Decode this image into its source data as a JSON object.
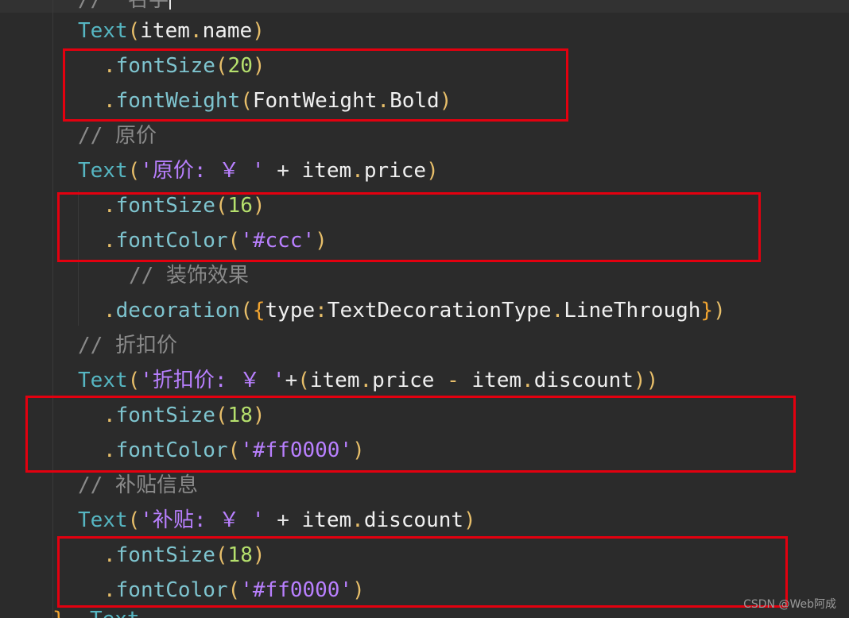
{
  "editor": {
    "lines": [
      {
        "id": "l0",
        "segments": [
          {
            "t": "//  ",
            "c": "tok-comment"
          },
          {
            "t": "名字",
            "c": "tok-comment"
          }
        ]
      },
      {
        "id": "l1",
        "segments": [
          {
            "t": "Text",
            "c": "tok-fn"
          },
          {
            "t": "(",
            "c": "tok-punc"
          },
          {
            "t": "item",
            "c": "tok-ident"
          },
          {
            "t": ".",
            "c": "tok-dot"
          },
          {
            "t": "name",
            "c": "tok-ident"
          },
          {
            "t": ")",
            "c": "tok-punc"
          }
        ]
      },
      {
        "id": "l2",
        "segments": [
          {
            "t": ".",
            "c": "tok-dot"
          },
          {
            "t": "fontSize",
            "c": "tok-method"
          },
          {
            "t": "(",
            "c": "tok-punc"
          },
          {
            "t": "20",
            "c": "tok-num"
          },
          {
            "t": ")",
            "c": "tok-punc"
          }
        ]
      },
      {
        "id": "l3",
        "segments": [
          {
            "t": ".",
            "c": "tok-dot"
          },
          {
            "t": "fontWeight",
            "c": "tok-method"
          },
          {
            "t": "(",
            "c": "tok-punc"
          },
          {
            "t": "FontWeight",
            "c": "tok-ident"
          },
          {
            "t": ".",
            "c": "tok-dot"
          },
          {
            "t": "Bold",
            "c": "tok-ident"
          },
          {
            "t": ")",
            "c": "tok-punc"
          }
        ]
      },
      {
        "id": "l4",
        "segments": [
          {
            "t": "// 原价",
            "c": "tok-comment"
          }
        ]
      },
      {
        "id": "l5",
        "segments": [
          {
            "t": "Text",
            "c": "tok-fn"
          },
          {
            "t": "(",
            "c": "tok-punc"
          },
          {
            "t": "'原价: ￥ '",
            "c": "tok-str"
          },
          {
            "t": " + ",
            "c": "tok-op"
          },
          {
            "t": "item",
            "c": "tok-ident"
          },
          {
            "t": ".",
            "c": "tok-dot"
          },
          {
            "t": "price",
            "c": "tok-ident"
          },
          {
            "t": ")",
            "c": "tok-punc"
          }
        ]
      },
      {
        "id": "l6",
        "segments": [
          {
            "t": ".",
            "c": "tok-dot"
          },
          {
            "t": "fontSize",
            "c": "tok-method"
          },
          {
            "t": "(",
            "c": "tok-punc"
          },
          {
            "t": "16",
            "c": "tok-num"
          },
          {
            "t": ")",
            "c": "tok-punc"
          }
        ]
      },
      {
        "id": "l7",
        "segments": [
          {
            "t": ".",
            "c": "tok-dot"
          },
          {
            "t": "fontColor",
            "c": "tok-method"
          },
          {
            "t": "(",
            "c": "tok-punc"
          },
          {
            "t": "'#ccc'",
            "c": "tok-str"
          },
          {
            "t": ")",
            "c": "tok-punc"
          }
        ]
      },
      {
        "id": "l8",
        "segments": [
          {
            "t": "// 装饰效果",
            "c": "tok-comment"
          }
        ]
      },
      {
        "id": "l9",
        "segments": [
          {
            "t": ".",
            "c": "tok-dot"
          },
          {
            "t": "decoration",
            "c": "tok-method"
          },
          {
            "t": "(",
            "c": "tok-punc"
          },
          {
            "t": "{",
            "c": "tok-brace"
          },
          {
            "t": "type",
            "c": "tok-ident"
          },
          {
            "t": ":",
            "c": "tok-dot"
          },
          {
            "t": "TextDecorationType",
            "c": "tok-ident"
          },
          {
            "t": ".",
            "c": "tok-dot"
          },
          {
            "t": "LineThrough",
            "c": "tok-ident"
          },
          {
            "t": "}",
            "c": "tok-brace"
          },
          {
            "t": ")",
            "c": "tok-punc"
          }
        ]
      },
      {
        "id": "l10",
        "segments": [
          {
            "t": "// 折扣价",
            "c": "tok-comment"
          }
        ]
      },
      {
        "id": "l11",
        "segments": [
          {
            "t": "Text",
            "c": "tok-fn"
          },
          {
            "t": "(",
            "c": "tok-punc"
          },
          {
            "t": "'折扣价: ￥ '",
            "c": "tok-str"
          },
          {
            "t": "+",
            "c": "tok-op"
          },
          {
            "t": "(",
            "c": "tok-punc"
          },
          {
            "t": "item",
            "c": "tok-ident"
          },
          {
            "t": ".",
            "c": "tok-dot"
          },
          {
            "t": "price",
            "c": "tok-ident"
          },
          {
            "t": " - ",
            "c": "tok-punc"
          },
          {
            "t": "item",
            "c": "tok-ident"
          },
          {
            "t": ".",
            "c": "tok-dot"
          },
          {
            "t": "discount",
            "c": "tok-ident"
          },
          {
            "t": "))",
            "c": "tok-punc"
          }
        ]
      },
      {
        "id": "l12",
        "segments": [
          {
            "t": ".",
            "c": "tok-dot"
          },
          {
            "t": "fontSize",
            "c": "tok-method"
          },
          {
            "t": "(",
            "c": "tok-punc"
          },
          {
            "t": "18",
            "c": "tok-num"
          },
          {
            "t": ")",
            "c": "tok-punc"
          }
        ]
      },
      {
        "id": "l13",
        "segments": [
          {
            "t": ".",
            "c": "tok-dot"
          },
          {
            "t": "fontColor",
            "c": "tok-method"
          },
          {
            "t": "(",
            "c": "tok-punc"
          },
          {
            "t": "'#ff0000'",
            "c": "tok-str"
          },
          {
            "t": ")",
            "c": "tok-punc"
          }
        ]
      },
      {
        "id": "l14",
        "segments": [
          {
            "t": "// 补贴信息",
            "c": "tok-comment"
          }
        ]
      },
      {
        "id": "l15",
        "segments": [
          {
            "t": "Text",
            "c": "tok-fn"
          },
          {
            "t": "(",
            "c": "tok-punc"
          },
          {
            "t": "'补贴: ￥ '",
            "c": "tok-str"
          },
          {
            "t": " + ",
            "c": "tok-op"
          },
          {
            "t": "item",
            "c": "tok-ident"
          },
          {
            "t": ".",
            "c": "tok-dot"
          },
          {
            "t": "discount",
            "c": "tok-ident"
          },
          {
            "t": ")",
            "c": "tok-punc"
          }
        ]
      },
      {
        "id": "l16",
        "segments": [
          {
            "t": ".",
            "c": "tok-dot"
          },
          {
            "t": "fontSize",
            "c": "tok-method"
          },
          {
            "t": "(",
            "c": "tok-punc"
          },
          {
            "t": "18",
            "c": "tok-num"
          },
          {
            "t": ")",
            "c": "tok-punc"
          }
        ]
      },
      {
        "id": "l17",
        "segments": [
          {
            "t": ".",
            "c": "tok-dot"
          },
          {
            "t": "fontColor",
            "c": "tok-method"
          },
          {
            "t": "(",
            "c": "tok-punc"
          },
          {
            "t": "'#ff0000'",
            "c": "tok-str"
          },
          {
            "t": ")",
            "c": "tok-punc"
          }
        ]
      },
      {
        "id": "l18",
        "segments": [
          {
            "t": "}",
            "c": "tok-brace"
          },
          {
            "t": "  ",
            "c": "tok-op"
          },
          {
            "t": "Text",
            "c": "tok-fn"
          },
          {
            "t": "...",
            "c": "tok-punc"
          }
        ]
      }
    ]
  },
  "watermark": "CSDN @Web阿成",
  "colors": {
    "background": "#2b2b2b",
    "highlight_box": "#e3000f",
    "function": "#56b6c2",
    "string": "#b980ff",
    "number": "#b5e06d",
    "comment": "#8a8a8a",
    "punctuation": "#e8bf6a"
  }
}
